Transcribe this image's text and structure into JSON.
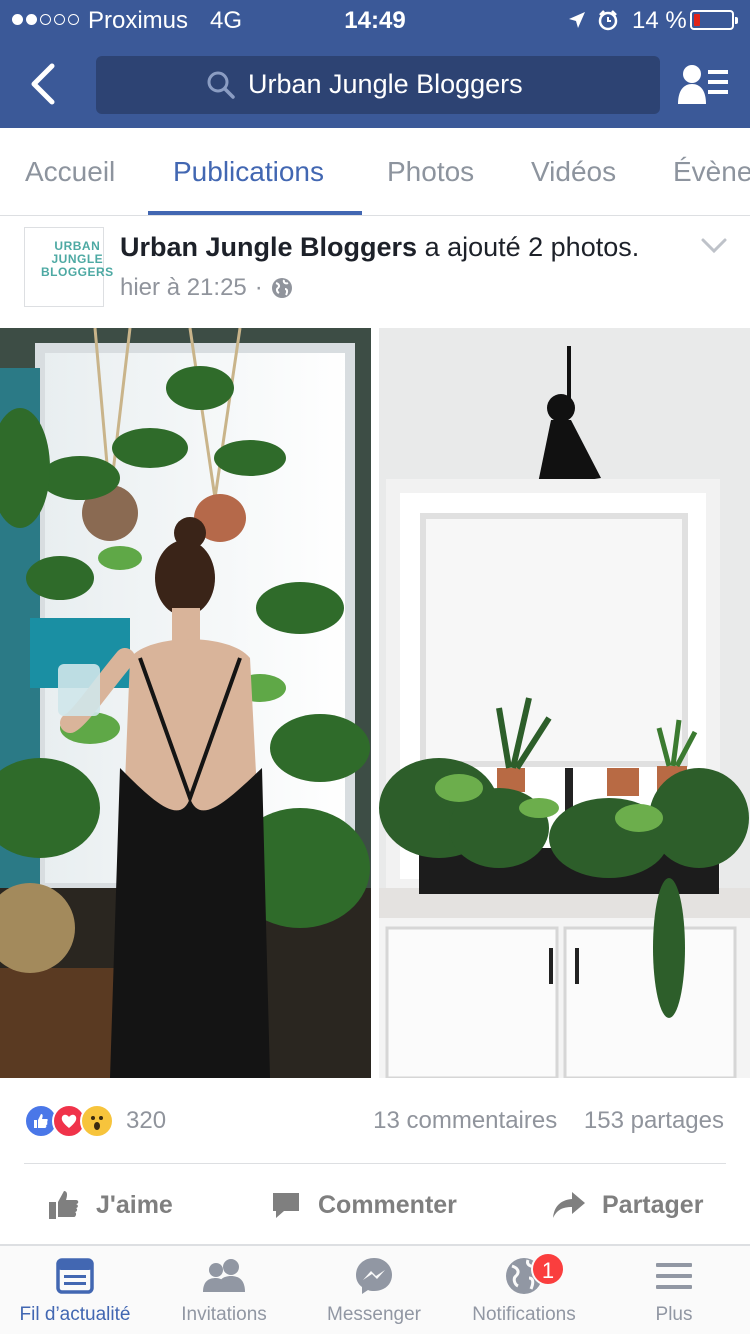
{
  "status_bar": {
    "carrier": "Proximus",
    "network": "4G",
    "time": "14:49",
    "battery_percent": "14 %",
    "battery_level": 0.14,
    "signal_bars_filled": 2,
    "signal_bars_total": 5,
    "icons": [
      "location-arrow-icon",
      "alarm-clock-icon",
      "battery-icon"
    ]
  },
  "header": {
    "search_text": "Urban Jungle Bloggers",
    "back_icon": "chevron-left-icon",
    "search_icon": "magnifier-icon",
    "right_icon": "friends-list-icon"
  },
  "tabs": [
    {
      "label": "Accueil",
      "active": false
    },
    {
      "label": "Publications",
      "active": true
    },
    {
      "label": "Photos",
      "active": false
    },
    {
      "label": "Vidéos",
      "active": false
    },
    {
      "label": "Évène",
      "active": false
    }
  ],
  "post": {
    "author": "Urban Jungle Bloggers",
    "action": "a ajouté 2 photos.",
    "timestamp": "hier à 21:25",
    "separator": "·",
    "privacy_icon": "globe-icon",
    "avatar_logo": [
      "URBAN",
      "JUNGLE",
      "BLOGGERS"
    ]
  },
  "photos": [
    {
      "alt_icon": "woman-with-plants-photo"
    },
    {
      "alt_icon": "kitchen-window-plants-photo"
    }
  ],
  "reactions": {
    "count": "320",
    "types": [
      "like",
      "love",
      "wow"
    ],
    "comments": "13 commentaires",
    "shares": "153 partages"
  },
  "actions": {
    "like": "J'aime",
    "comment": "Commenter",
    "share": "Partager"
  },
  "bottom_nav": [
    {
      "label": "Fil d’actualité",
      "icon": "news-feed-icon",
      "active": true
    },
    {
      "label": "Invitations",
      "icon": "friends-icon",
      "active": false
    },
    {
      "label": "Messenger",
      "icon": "messenger-icon",
      "active": false
    },
    {
      "label": "Notifications",
      "icon": "globe-notifications-icon",
      "active": false,
      "badge": "1"
    },
    {
      "label": "Plus",
      "icon": "menu-icon",
      "active": false
    }
  ],
  "colors": {
    "brand": "#3b5998",
    "accent": "#4267b2",
    "badge": "#fa3e3e",
    "muted": "#90949c"
  }
}
